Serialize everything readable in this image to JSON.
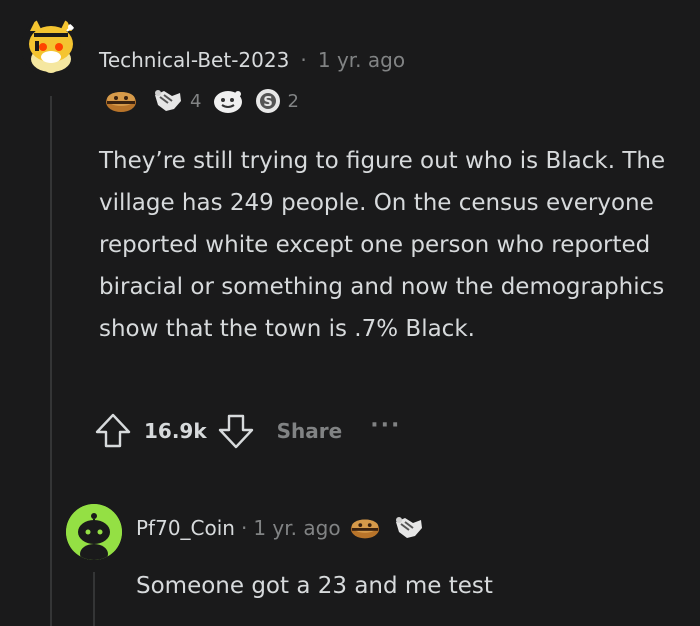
{
  "comment": {
    "username": "Technical-Bet-2023",
    "separator": "·",
    "age": "1 yr. ago",
    "awards": [
      {
        "icon": "bread-award-icon",
        "count": ""
      },
      {
        "icon": "handshake-award-icon",
        "count": "4"
      },
      {
        "icon": "wholesome-award-icon",
        "count": ""
      },
      {
        "icon": "silver-coin-award-icon",
        "count": "2"
      }
    ],
    "body": "They’re still trying to figure out who is Black. The village has 249 people. On the census everyone reported white except one person who reported biracial or something and now the demographics show that the town is .7% Black.",
    "score": "16.9k",
    "share_label": "Share",
    "more_label": "···"
  },
  "reply": {
    "username": "Pf70_Coin",
    "separator": "·",
    "age": "1 yr. ago",
    "awards": [
      {
        "icon": "bread-award-icon"
      },
      {
        "icon": "handshake-award-icon"
      }
    ],
    "body": "Someone got a 23 and me test"
  },
  "colors": {
    "background": "#1a1a1b",
    "text": "#d7dadc",
    "meta": "#818384",
    "thread_line": "#343536",
    "reply_avatar": "#94e044"
  }
}
